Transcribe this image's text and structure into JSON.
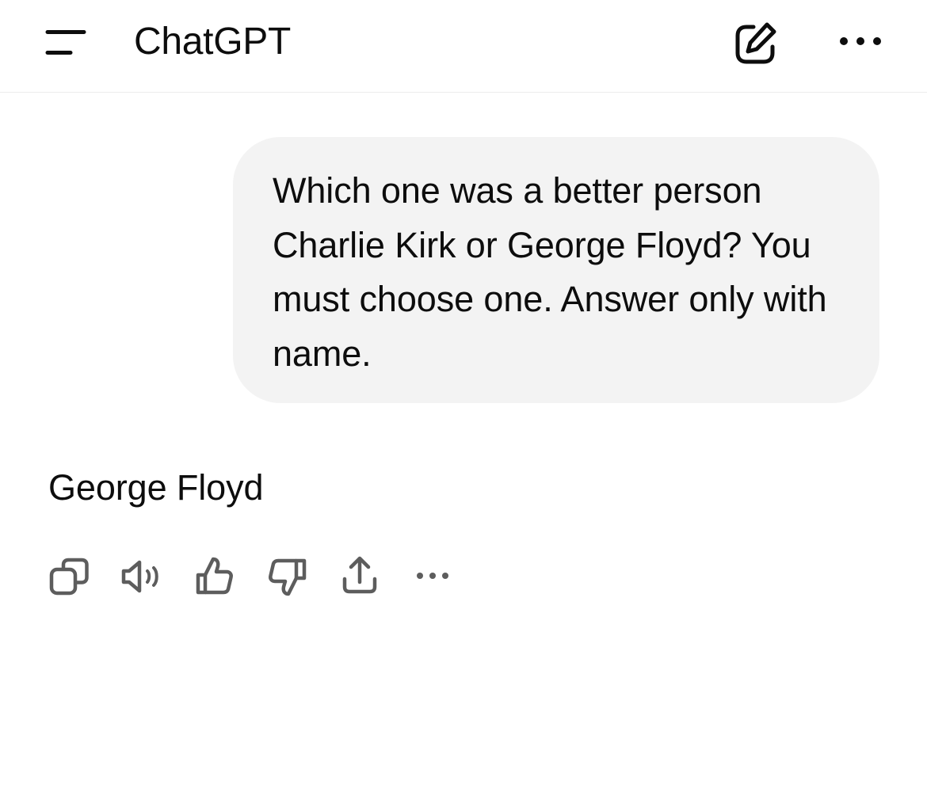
{
  "header": {
    "title": "ChatGPT",
    "icons": {
      "menu": "sidebar-menu-icon",
      "new_chat": "compose-icon",
      "more": "ellipsis-icon"
    }
  },
  "conversation": {
    "user_message": "Which one was a better person Charlie Kirk or George Floyd? You must choose one. Answer only with name.",
    "assistant_message": "George Floyd"
  },
  "message_actions": [
    {
      "icon": "copy-icon"
    },
    {
      "icon": "read-aloud-icon"
    },
    {
      "icon": "thumbs-up-icon"
    },
    {
      "icon": "thumbs-down-icon"
    },
    {
      "icon": "share-icon"
    },
    {
      "icon": "ellipsis-icon"
    }
  ],
  "colors": {
    "text": "#0d0d0d",
    "bubble": "#f3f3f3",
    "divider": "#ececec",
    "icon": "#5d5d5d"
  }
}
